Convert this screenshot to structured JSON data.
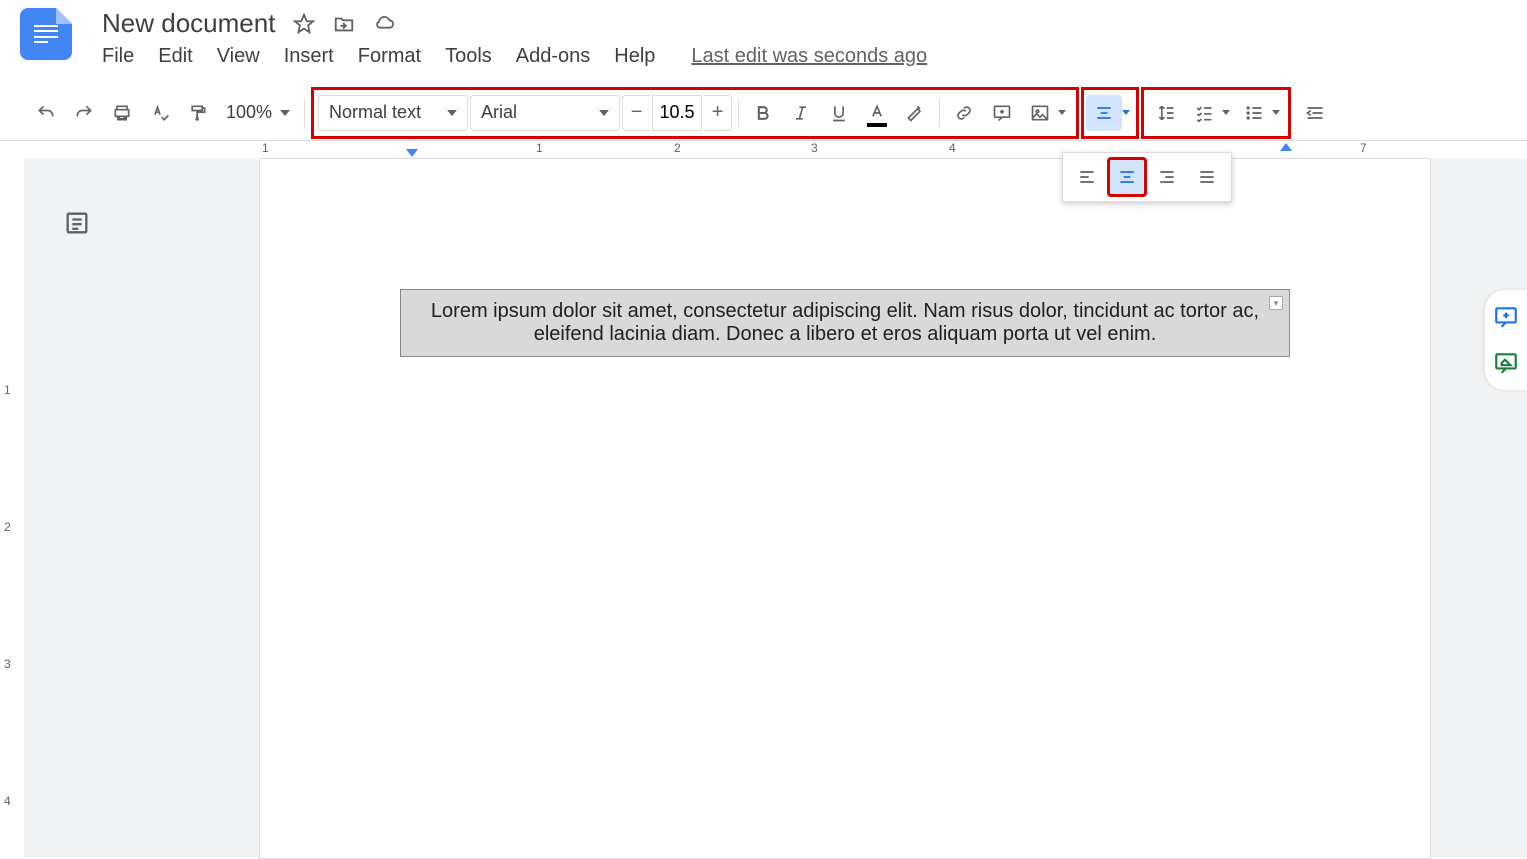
{
  "header": {
    "doc_title": "New document",
    "menu": {
      "file": "File",
      "edit": "Edit",
      "view": "View",
      "insert": "Insert",
      "format": "Format",
      "tools": "Tools",
      "addons": "Add-ons",
      "help": "Help"
    },
    "last_edit": "Last edit was seconds ago"
  },
  "toolbar": {
    "zoom": "100%",
    "style": "Normal text",
    "font": "Arial",
    "font_size": "10.5"
  },
  "ruler": {
    "h_numbers": [
      "1",
      "1",
      "2",
      "3",
      "4",
      "7"
    ],
    "v_numbers": [
      "1",
      "2",
      "3",
      "4"
    ]
  },
  "document": {
    "text": "Lorem ipsum dolor sit amet, consectetur adipiscing elit. Nam risus dolor, tincidunt ac tortor ac, eleifend lacinia diam. Donec a libero et eros aliquam porta ut vel enim."
  }
}
